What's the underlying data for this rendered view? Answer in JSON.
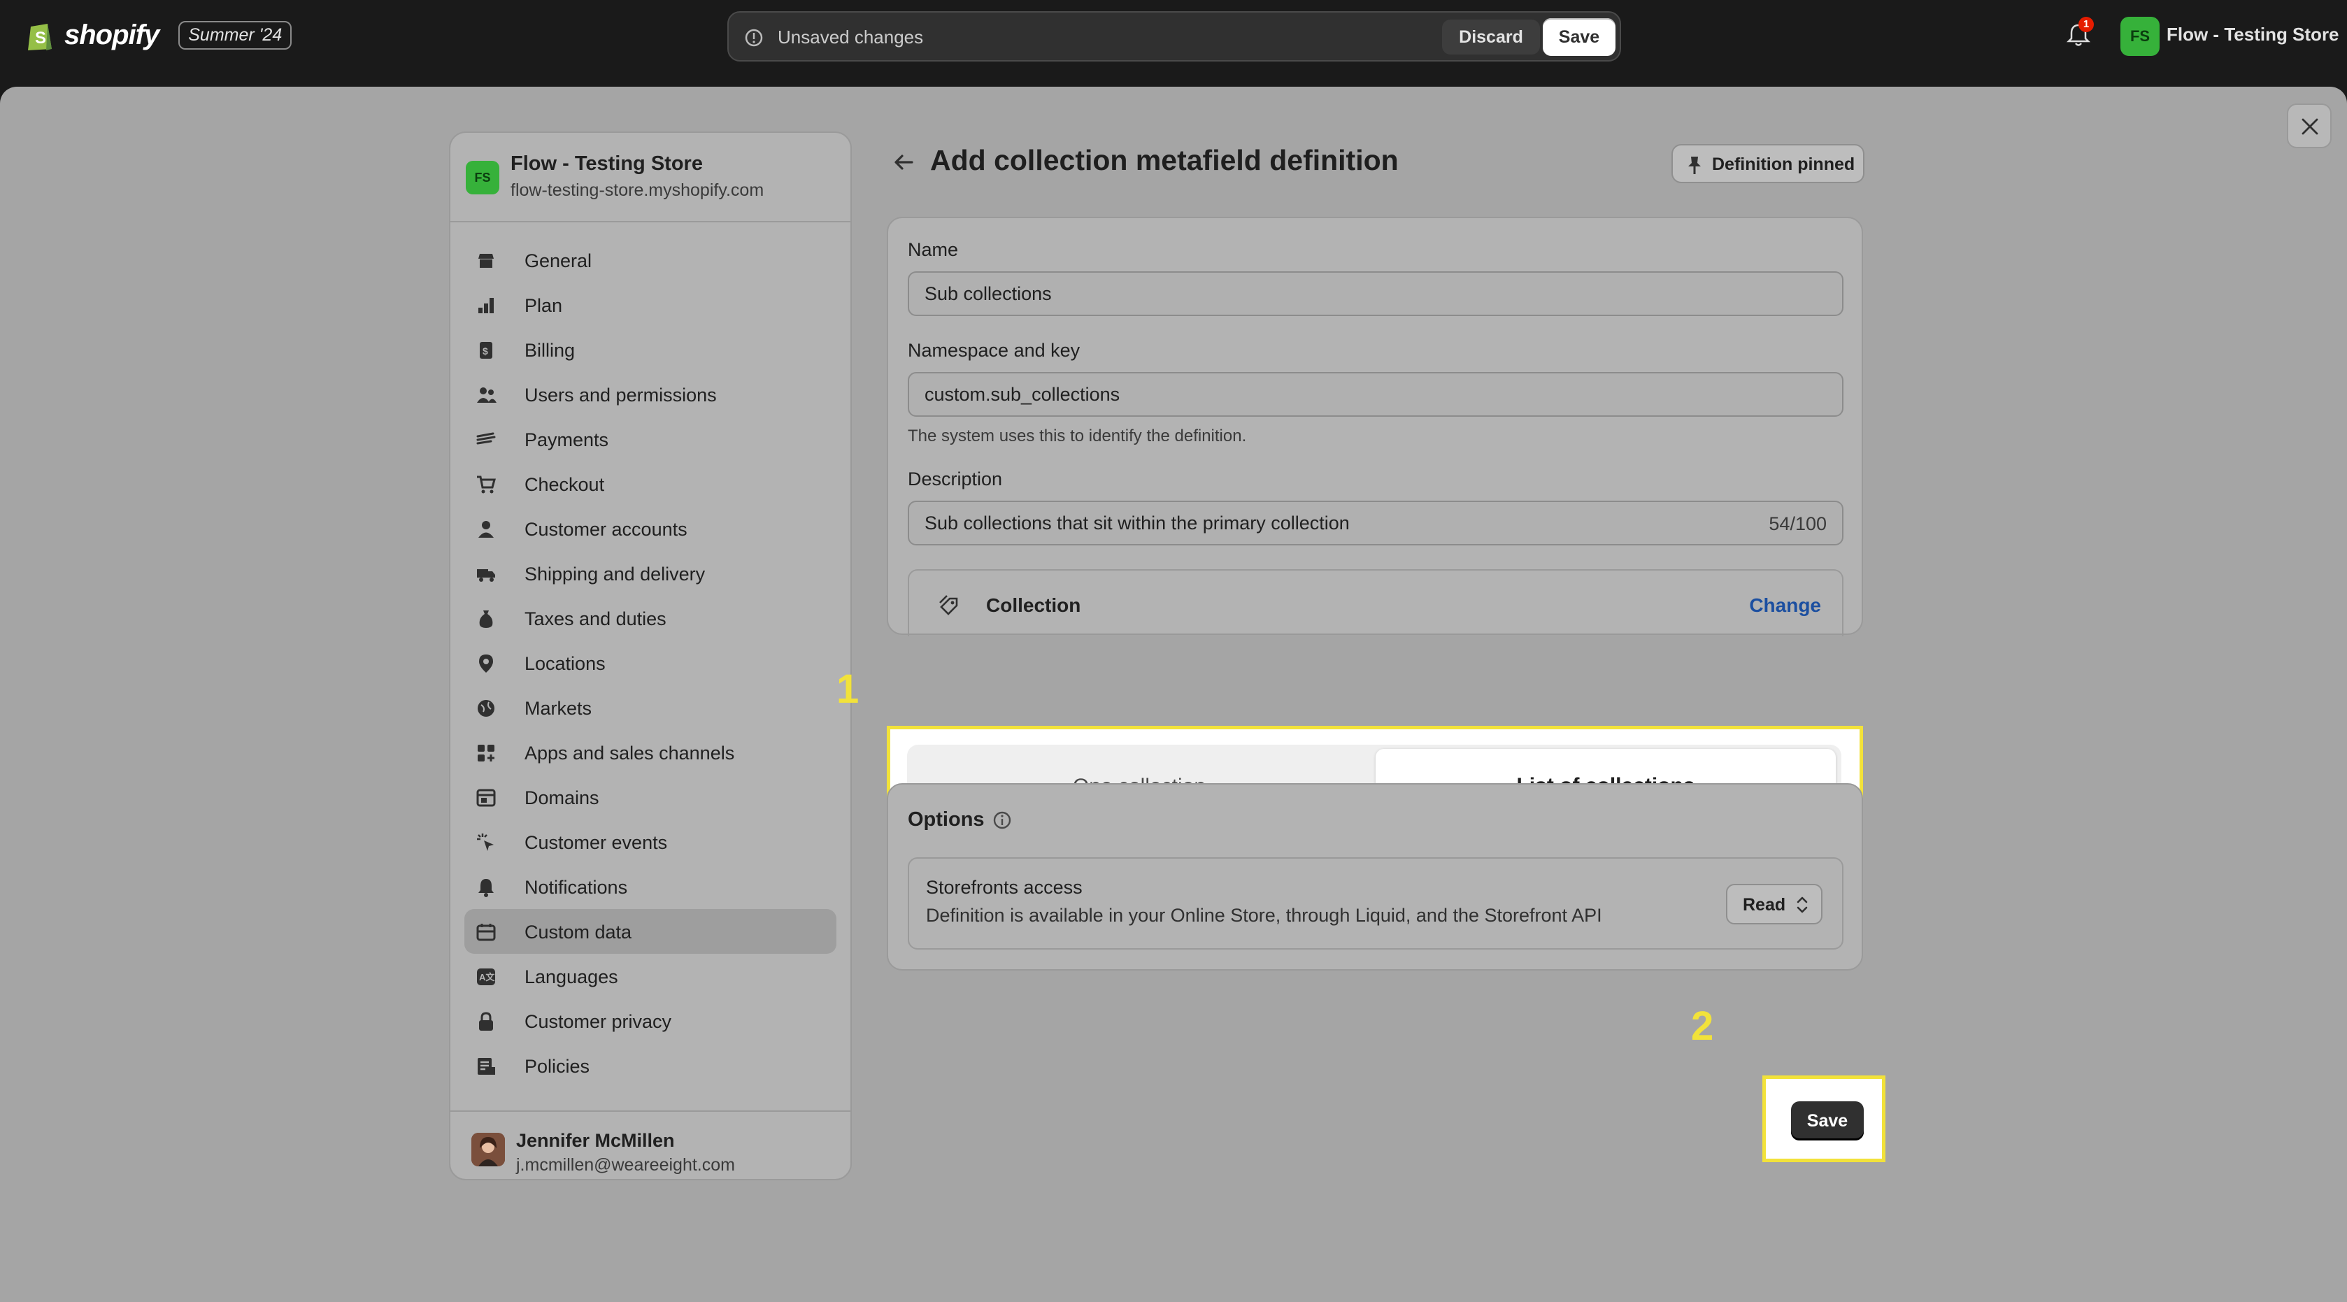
{
  "topbar": {
    "brand": "shopify",
    "edition": "Summer '24",
    "unsaved_text": "Unsaved changes",
    "discard_label": "Discard",
    "save_label": "Save",
    "notification_count": "1",
    "store_initials": "FS",
    "store_name": "Flow - Testing Store"
  },
  "sidebar": {
    "store_initials": "FS",
    "store_name": "Flow - Testing Store",
    "store_url": "flow-testing-store.myshopify.com",
    "items": [
      {
        "label": "General",
        "icon": "store-icon"
      },
      {
        "label": "Plan",
        "icon": "plan-icon"
      },
      {
        "label": "Billing",
        "icon": "billing-icon"
      },
      {
        "label": "Users and permissions",
        "icon": "users-icon"
      },
      {
        "label": "Payments",
        "icon": "payments-icon"
      },
      {
        "label": "Checkout",
        "icon": "cart-icon"
      },
      {
        "label": "Customer accounts",
        "icon": "person-icon"
      },
      {
        "label": "Shipping and delivery",
        "icon": "truck-icon"
      },
      {
        "label": "Taxes and duties",
        "icon": "taxes-icon"
      },
      {
        "label": "Locations",
        "icon": "location-icon"
      },
      {
        "label": "Markets",
        "icon": "globe-icon"
      },
      {
        "label": "Apps and sales channels",
        "icon": "apps-icon"
      },
      {
        "label": "Domains",
        "icon": "domains-icon"
      },
      {
        "label": "Customer events",
        "icon": "events-icon"
      },
      {
        "label": "Notifications",
        "icon": "bell-icon"
      },
      {
        "label": "Custom data",
        "icon": "custom-data-icon"
      },
      {
        "label": "Languages",
        "icon": "languages-icon"
      },
      {
        "label": "Customer privacy",
        "icon": "lock-icon"
      },
      {
        "label": "Policies",
        "icon": "policies-icon"
      }
    ],
    "active_item": "Custom data",
    "user_name": "Jennifer McMillen",
    "user_email": "j.mcmillen@weareeight.com"
  },
  "main": {
    "title": "Add collection metafield definition",
    "pinned_label": "Definition pinned",
    "name_label": "Name",
    "name_value": "Sub collections",
    "namespace_label": "Namespace and key",
    "namespace_value": "custom.sub_collections",
    "namespace_help": "The system uses this to identify the definition.",
    "description_label": "Description",
    "description_value": "Sub collections that sit within the primary collection",
    "description_count": "54/100",
    "type_label": "Collection",
    "change_label": "Change",
    "option_one": "One collection",
    "option_list": "List of collections",
    "selected_option": "List of collections",
    "options_title": "Options",
    "storefront_title": "Storefronts access",
    "storefront_desc": "Definition is available in your Online Store, through Liquid, and the Storefront API",
    "access_value": "Read",
    "save_label": "Save"
  },
  "annotations": {
    "step1": "1",
    "step2": "2",
    "highlight_color": "#f2e23a"
  }
}
